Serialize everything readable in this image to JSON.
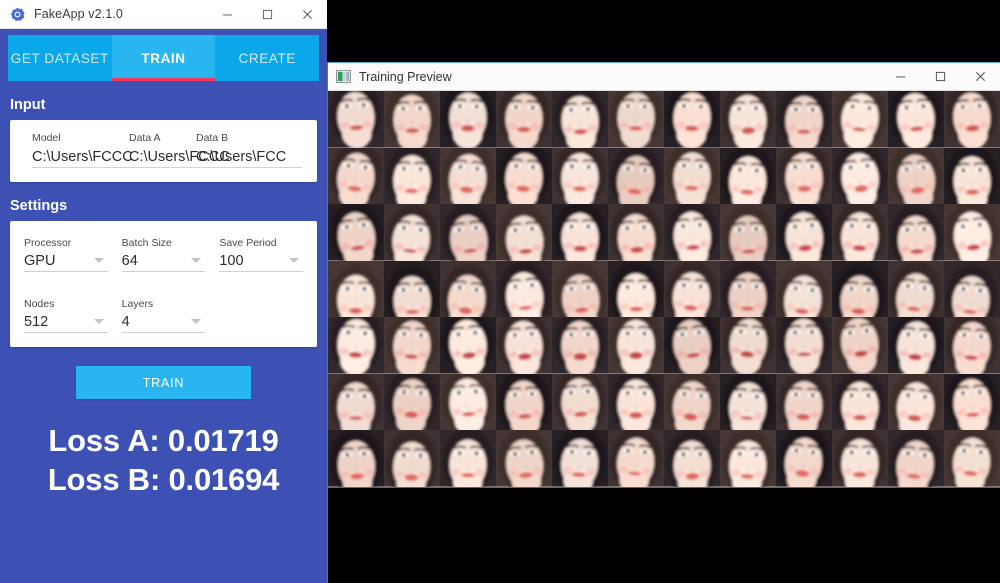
{
  "fakeapp": {
    "titlebar": {
      "icon": "gear-icon",
      "title": "FakeApp v2.1.0",
      "minimize": "–",
      "maximize": "☐",
      "close": "✕"
    },
    "tabs": [
      {
        "label": "GET DATASET",
        "active": false
      },
      {
        "label": "TRAIN",
        "active": true
      },
      {
        "label": "CREATE",
        "active": false
      }
    ],
    "input_section": {
      "heading": "Input",
      "fields": [
        {
          "label": "Model",
          "value": "C:\\Users\\FCCC"
        },
        {
          "label": "Data A",
          "value": "C:\\Users\\FCCC"
        },
        {
          "label": "Data B",
          "value": "C:\\Users\\FCC"
        }
      ]
    },
    "settings_section": {
      "heading": "Settings",
      "row1": [
        {
          "label": "Processor",
          "value": "GPU"
        },
        {
          "label": "Batch Size",
          "value": "64"
        },
        {
          "label": "Save Period",
          "value": "100"
        }
      ],
      "row2": [
        {
          "label": "Nodes",
          "value": "512"
        },
        {
          "label": "Layers",
          "value": "4"
        }
      ]
    },
    "train_button": "TRAIN",
    "loss": {
      "a": "Loss A: 0.01719",
      "b": "Loss B: 0.01694"
    },
    "colors": {
      "panel": "#3d51b5",
      "tab_active": "#29b6f0",
      "tab_inactive": "#0aa8e8",
      "tab_underline": "#f0375e",
      "button": "#29b6f0",
      "card": "#ffffff"
    }
  },
  "preview": {
    "titlebar": {
      "icon": "image-preview-icon",
      "title": "Training Preview",
      "minimize": "–",
      "maximize": "☐",
      "close": "✕"
    },
    "grid": {
      "columns": 12,
      "rows": 7,
      "cell_count": 84,
      "description": "blurred face thumbnails",
      "border_color": "#3b6ea8"
    },
    "background": "#000000"
  }
}
